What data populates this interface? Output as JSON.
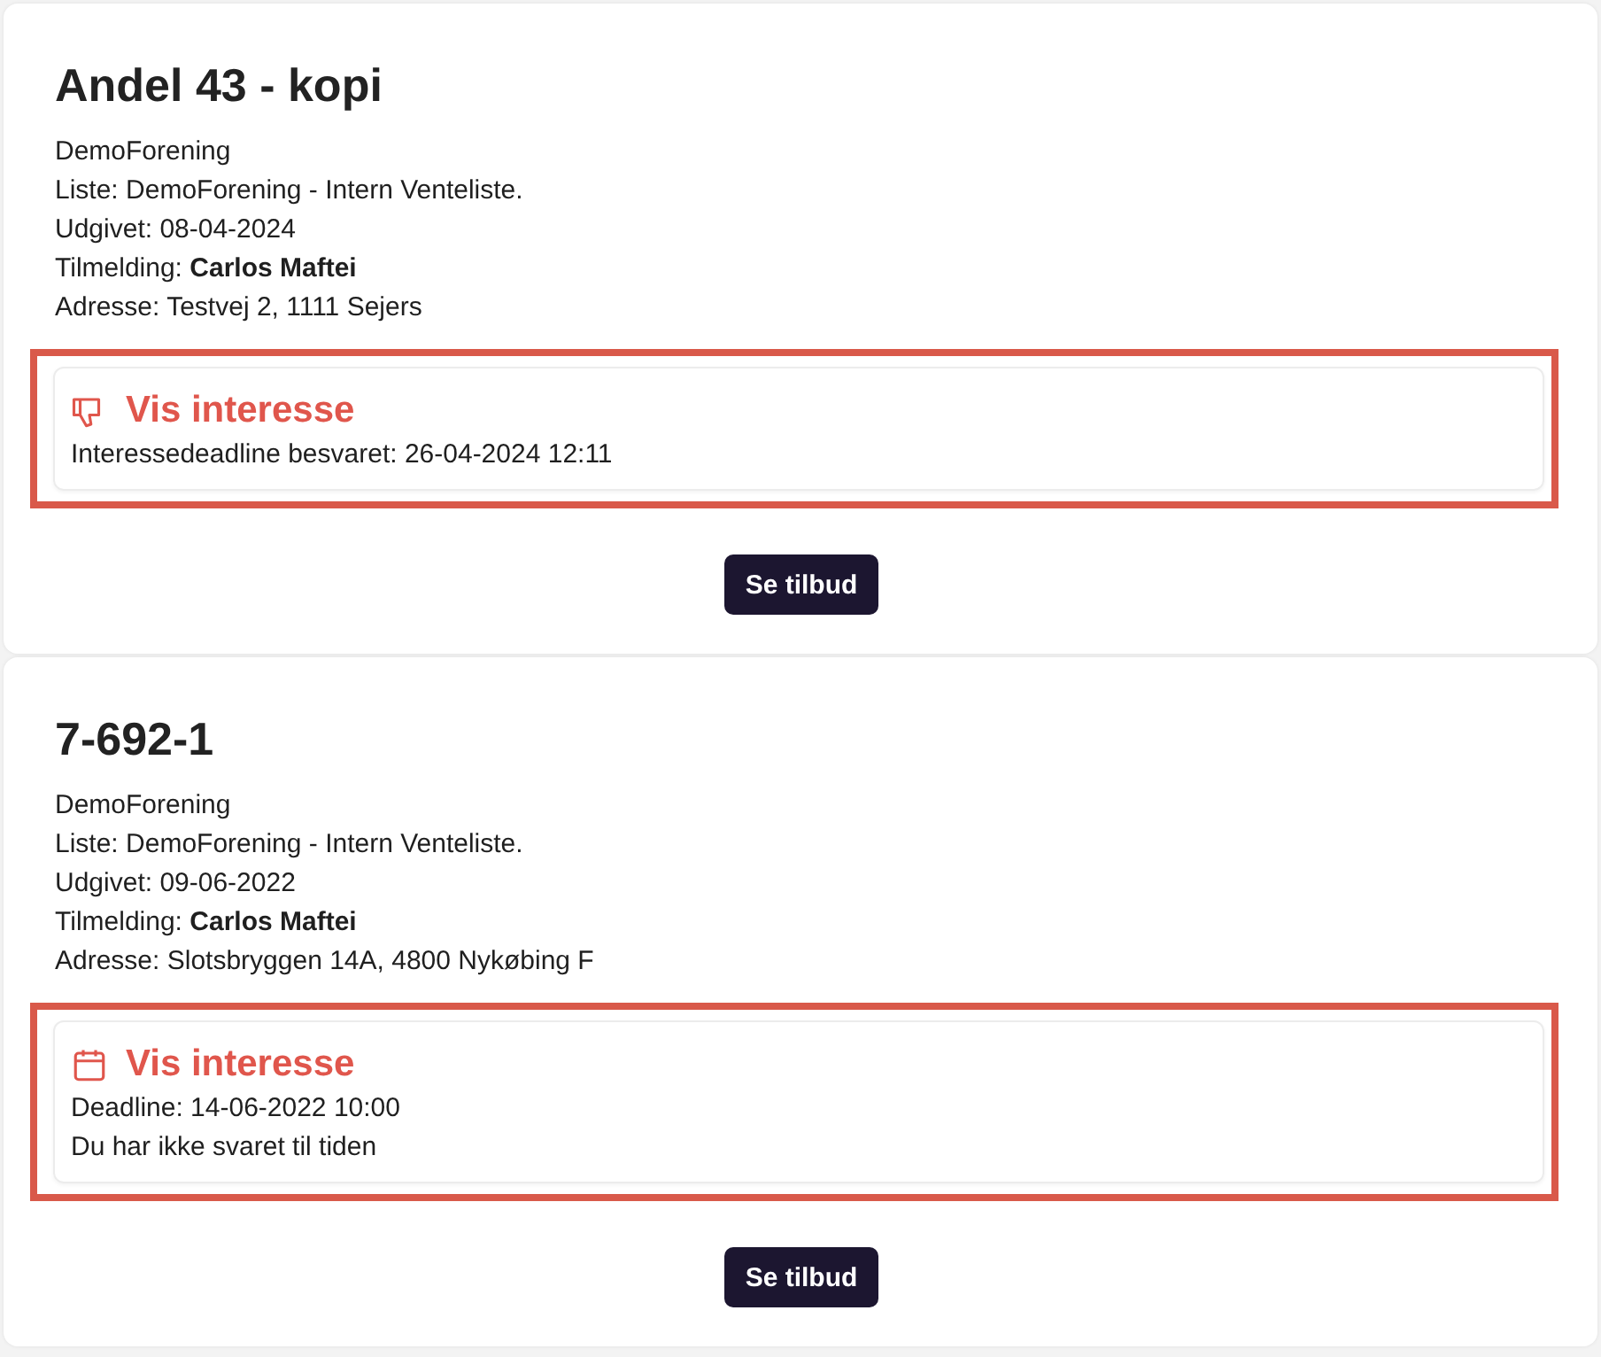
{
  "listings": [
    {
      "title": "Andel 43 - kopi",
      "details": [
        "DemoForening",
        "Liste: DemoForening - Intern Venteliste.",
        "Udgivet: 08-04-2024",
        "Tilmelding: **Carlos Maftei**",
        "Adresse: Testvej 2, 1111 Sejers"
      ],
      "interest": {
        "kind": "answered",
        "title": "Vis interesse",
        "lines": [
          "Interessedeadline besvaret: 26-04-2024 12:11"
        ]
      },
      "button": "Se tilbud"
    },
    {
      "title": "7-692-1",
      "details": [
        "DemoForening",
        "Liste: DemoForening - Intern Venteliste.",
        "Udgivet: 09-06-2022",
        "Tilmelding: **Carlos Maftei**",
        "Adresse: Slotsbryggen 14A, 4800 Nykøbing F"
      ],
      "interest": {
        "kind": "deadline",
        "title": "Vis interesse",
        "lines": [
          "Deadline: 14-06-2022 10:00",
          "Du har ikke svaret til tiden"
        ]
      },
      "button": "Se tilbud"
    }
  ]
}
